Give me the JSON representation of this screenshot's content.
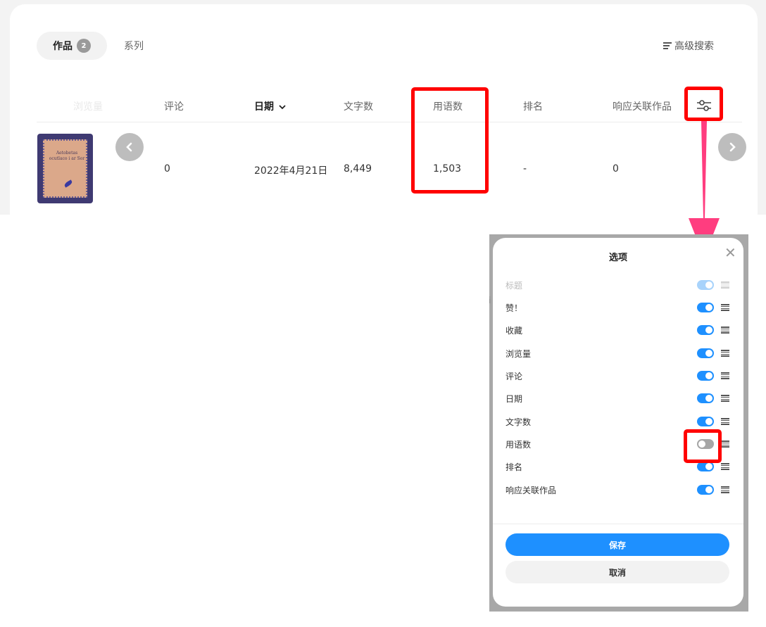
{
  "tabs": {
    "active_label": "作品",
    "active_count": "2",
    "series_label": "系列"
  },
  "advanced_search": {
    "label": "高级搜索",
    "icon": "menu-lines-icon"
  },
  "table": {
    "headers": {
      "faded": "浏览量",
      "comments": "评论",
      "date": "日期",
      "chars": "文字数",
      "words": "用语数",
      "rank": "排名",
      "related": "响应关联作品"
    },
    "row": {
      "cover_text": "Aetobetas ocutlaco i ar Sor",
      "comments": "0",
      "date": "2022年4月21日",
      "chars": "8,449",
      "words": "1,503",
      "rank": "-",
      "related": "0"
    }
  },
  "modal": {
    "title": "选项",
    "options": [
      {
        "label": "标题",
        "state": "disabled"
      },
      {
        "label": "赞！",
        "state": "on"
      },
      {
        "label": "收藏",
        "state": "on"
      },
      {
        "label": "浏览量",
        "state": "on"
      },
      {
        "label": "评论",
        "state": "on"
      },
      {
        "label": "日期",
        "state": "on"
      },
      {
        "label": "文字数",
        "state": "on"
      },
      {
        "label": "用语数",
        "state": "off"
      },
      {
        "label": "排名",
        "state": "on"
      },
      {
        "label": "响应关联作品",
        "state": "on"
      }
    ],
    "save_label": "保存",
    "cancel_label": "取消"
  },
  "colors": {
    "accent": "#1e90ff",
    "highlight": "#ff0000",
    "arrow": "#ff3d7f"
  }
}
